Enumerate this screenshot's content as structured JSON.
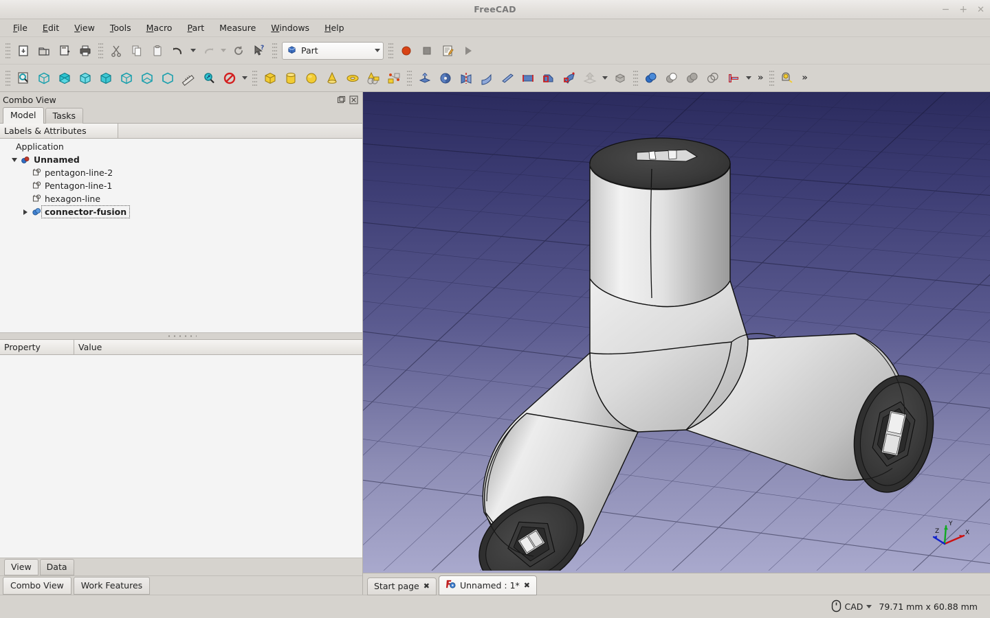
{
  "window": {
    "title": "FreeCAD",
    "controls": {
      "minimize": "−",
      "maximize": "+",
      "close": "✕"
    }
  },
  "menubar": {
    "items": [
      {
        "label": "File"
      },
      {
        "label": "Edit"
      },
      {
        "label": "View"
      },
      {
        "label": "Tools"
      },
      {
        "label": "Macro"
      },
      {
        "label": "Part"
      },
      {
        "label": "Measure"
      },
      {
        "label": "Windows"
      },
      {
        "label": "Help"
      }
    ]
  },
  "toolbars": {
    "file": [
      {
        "name": "new-document-icon",
        "title": "New"
      },
      {
        "name": "open-document-icon",
        "title": "Open"
      },
      {
        "name": "save-document-icon",
        "title": "Save"
      },
      {
        "name": "print-icon",
        "title": "Print"
      }
    ],
    "edit": [
      {
        "name": "cut-icon",
        "title": "Cut"
      },
      {
        "name": "copy-icon",
        "title": "Copy"
      },
      {
        "name": "paste-icon",
        "title": "Paste"
      },
      {
        "name": "undo-icon",
        "title": "Undo"
      },
      {
        "name": "redo-icon",
        "title": "Redo"
      },
      {
        "name": "refresh-icon",
        "title": "Refresh"
      },
      {
        "name": "whats-this-icon",
        "title": "What's This"
      }
    ],
    "workbench": {
      "selected": "Part",
      "icon": "part-workbench-icon"
    },
    "macro": [
      {
        "name": "macro-record-icon",
        "title": "Macro recording"
      },
      {
        "name": "macro-stop-icon",
        "title": "Stop macro recording"
      },
      {
        "name": "macro-edit-icon",
        "title": "Macros"
      },
      {
        "name": "macro-execute-icon",
        "title": "Execute macro"
      }
    ],
    "view": [
      {
        "name": "fit-all-icon",
        "title": "Fit all"
      },
      {
        "name": "axonometric-view-icon",
        "title": "Axonometric"
      },
      {
        "name": "front-view-icon",
        "title": "Front"
      },
      {
        "name": "top-view-icon",
        "title": "Top"
      },
      {
        "name": "right-view-icon",
        "title": "Right"
      },
      {
        "name": "rear-view-icon",
        "title": "Rear"
      },
      {
        "name": "bottom-view-icon",
        "title": "Bottom"
      },
      {
        "name": "left-view-icon",
        "title": "Left"
      },
      {
        "name": "measure-ruler-icon",
        "title": "Measure"
      },
      {
        "name": "zoom-icon",
        "title": "Zoom"
      },
      {
        "name": "draw-style-icon",
        "title": "Draw style"
      }
    ],
    "primitives": [
      {
        "name": "box-icon",
        "title": "Cube"
      },
      {
        "name": "cylinder-icon",
        "title": "Cylinder"
      },
      {
        "name": "sphere-icon",
        "title": "Sphere"
      },
      {
        "name": "cone-icon",
        "title": "Cone"
      },
      {
        "name": "torus-icon",
        "title": "Torus"
      },
      {
        "name": "primitives-dialog-icon",
        "title": "Create primitives"
      },
      {
        "name": "shape-builder-icon",
        "title": "Shape builder"
      }
    ],
    "part_tools": [
      {
        "name": "extrude-icon",
        "title": "Extrude"
      },
      {
        "name": "revolve-icon",
        "title": "Revolve"
      },
      {
        "name": "mirror-icon",
        "title": "Mirroring"
      },
      {
        "name": "fillet-icon",
        "title": "Fillet"
      },
      {
        "name": "chamfer-icon",
        "title": "Chamfer"
      },
      {
        "name": "ruled-surface-icon",
        "title": "Ruled surface"
      },
      {
        "name": "loft-icon",
        "title": "Loft"
      },
      {
        "name": "sweep-icon",
        "title": "Sweep"
      },
      {
        "name": "section-icon",
        "title": "Section",
        "disabled": true
      }
    ],
    "boolean": [
      {
        "name": "compound-icon",
        "title": "Compound"
      },
      {
        "name": "boolean-icon",
        "title": "Boolean"
      },
      {
        "name": "cut-shape-icon",
        "title": "Cut"
      },
      {
        "name": "union-icon",
        "title": "Union"
      },
      {
        "name": "intersection-icon",
        "title": "Intersection"
      },
      {
        "name": "join-connect-icon",
        "title": "Join objects"
      }
    ],
    "measure_tb": [
      {
        "name": "measure-tape-icon",
        "title": "Measure"
      }
    ],
    "overflow_label": "»"
  },
  "combo_view": {
    "title": "Combo View",
    "float_icon": "float-dock-icon",
    "close_icon": "close-dock-icon",
    "tabs": [
      {
        "label": "Model",
        "active": true
      },
      {
        "label": "Tasks",
        "active": false
      }
    ],
    "tree_header": {
      "labels_col": "Labels & Attributes",
      "value_col": ""
    },
    "tree": [
      {
        "label": "Application",
        "indent": 0,
        "twisty": "none",
        "icon": "none",
        "bold": false,
        "focus": false
      },
      {
        "label": "Unnamed",
        "indent": 1,
        "twisty": "down",
        "icon": "document-icon",
        "bold": true,
        "focus": false
      },
      {
        "label": "pentagon-line-2",
        "indent": 2,
        "twisty": "none",
        "icon": "sketch-icon",
        "bold": false,
        "focus": false
      },
      {
        "label": "Pentagon-line-1",
        "indent": 2,
        "twisty": "none",
        "icon": "sketch-icon",
        "bold": false,
        "focus": false
      },
      {
        "label": "hexagon-line",
        "indent": 2,
        "twisty": "none",
        "icon": "sketch-icon",
        "bold": false,
        "focus": false
      },
      {
        "label": "connector-fusion",
        "indent": 2,
        "twisty": "right",
        "icon": "fusion-icon",
        "bold": true,
        "focus": true
      }
    ],
    "property_table": {
      "columns": [
        "Property",
        "Value"
      ],
      "rows": []
    },
    "property_tabs": [
      {
        "label": "View",
        "active": true
      },
      {
        "label": "Data",
        "active": false
      }
    ]
  },
  "dock_tabs": [
    {
      "label": "Combo View",
      "active": true
    },
    {
      "label": "Work Features",
      "active": false
    }
  ],
  "viewport": {
    "background_top": "#2b2b5e",
    "background_bottom": "#a9a9cd",
    "grid_color": "#3a3a5e",
    "model_name": "connector-fusion",
    "axis_indicator": {
      "x": {
        "label": "X",
        "color": "#cc1111"
      },
      "y": {
        "label": "Y",
        "color": "#11aa22"
      },
      "z": {
        "label": "Z",
        "color": "#1122cc"
      }
    }
  },
  "document_tabs": [
    {
      "label": "Start page",
      "active": false,
      "icon": "none",
      "close": "✖"
    },
    {
      "label": "Unnamed : 1*",
      "active": true,
      "icon": "freecad-doc-icon",
      "close": "✖"
    }
  ],
  "statusbar": {
    "nav_icon": "mouse-icon",
    "nav_style": "CAD",
    "dimensions": "79.71 mm x 60.88 mm"
  }
}
